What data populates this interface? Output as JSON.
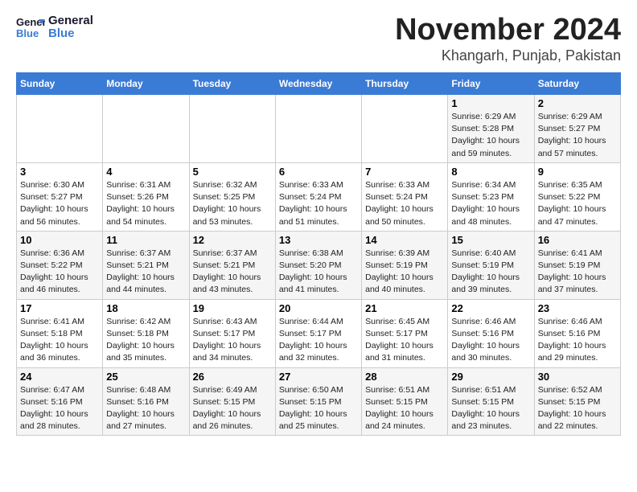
{
  "header": {
    "logo_line1": "General",
    "logo_line2": "Blue",
    "month": "November 2024",
    "location": "Khangarh, Punjab, Pakistan"
  },
  "weekdays": [
    "Sunday",
    "Monday",
    "Tuesday",
    "Wednesday",
    "Thursday",
    "Friday",
    "Saturday"
  ],
  "weeks": [
    [
      {
        "day": "",
        "info": ""
      },
      {
        "day": "",
        "info": ""
      },
      {
        "day": "",
        "info": ""
      },
      {
        "day": "",
        "info": ""
      },
      {
        "day": "",
        "info": ""
      },
      {
        "day": "1",
        "info": "Sunrise: 6:29 AM\nSunset: 5:28 PM\nDaylight: 10 hours\nand 59 minutes."
      },
      {
        "day": "2",
        "info": "Sunrise: 6:29 AM\nSunset: 5:27 PM\nDaylight: 10 hours\nand 57 minutes."
      }
    ],
    [
      {
        "day": "3",
        "info": "Sunrise: 6:30 AM\nSunset: 5:27 PM\nDaylight: 10 hours\nand 56 minutes."
      },
      {
        "day": "4",
        "info": "Sunrise: 6:31 AM\nSunset: 5:26 PM\nDaylight: 10 hours\nand 54 minutes."
      },
      {
        "day": "5",
        "info": "Sunrise: 6:32 AM\nSunset: 5:25 PM\nDaylight: 10 hours\nand 53 minutes."
      },
      {
        "day": "6",
        "info": "Sunrise: 6:33 AM\nSunset: 5:24 PM\nDaylight: 10 hours\nand 51 minutes."
      },
      {
        "day": "7",
        "info": "Sunrise: 6:33 AM\nSunset: 5:24 PM\nDaylight: 10 hours\nand 50 minutes."
      },
      {
        "day": "8",
        "info": "Sunrise: 6:34 AM\nSunset: 5:23 PM\nDaylight: 10 hours\nand 48 minutes."
      },
      {
        "day": "9",
        "info": "Sunrise: 6:35 AM\nSunset: 5:22 PM\nDaylight: 10 hours\nand 47 minutes."
      }
    ],
    [
      {
        "day": "10",
        "info": "Sunrise: 6:36 AM\nSunset: 5:22 PM\nDaylight: 10 hours\nand 46 minutes."
      },
      {
        "day": "11",
        "info": "Sunrise: 6:37 AM\nSunset: 5:21 PM\nDaylight: 10 hours\nand 44 minutes."
      },
      {
        "day": "12",
        "info": "Sunrise: 6:37 AM\nSunset: 5:21 PM\nDaylight: 10 hours\nand 43 minutes."
      },
      {
        "day": "13",
        "info": "Sunrise: 6:38 AM\nSunset: 5:20 PM\nDaylight: 10 hours\nand 41 minutes."
      },
      {
        "day": "14",
        "info": "Sunrise: 6:39 AM\nSunset: 5:19 PM\nDaylight: 10 hours\nand 40 minutes."
      },
      {
        "day": "15",
        "info": "Sunrise: 6:40 AM\nSunset: 5:19 PM\nDaylight: 10 hours\nand 39 minutes."
      },
      {
        "day": "16",
        "info": "Sunrise: 6:41 AM\nSunset: 5:19 PM\nDaylight: 10 hours\nand 37 minutes."
      }
    ],
    [
      {
        "day": "17",
        "info": "Sunrise: 6:41 AM\nSunset: 5:18 PM\nDaylight: 10 hours\nand 36 minutes."
      },
      {
        "day": "18",
        "info": "Sunrise: 6:42 AM\nSunset: 5:18 PM\nDaylight: 10 hours\nand 35 minutes."
      },
      {
        "day": "19",
        "info": "Sunrise: 6:43 AM\nSunset: 5:17 PM\nDaylight: 10 hours\nand 34 minutes."
      },
      {
        "day": "20",
        "info": "Sunrise: 6:44 AM\nSunset: 5:17 PM\nDaylight: 10 hours\nand 32 minutes."
      },
      {
        "day": "21",
        "info": "Sunrise: 6:45 AM\nSunset: 5:17 PM\nDaylight: 10 hours\nand 31 minutes."
      },
      {
        "day": "22",
        "info": "Sunrise: 6:46 AM\nSunset: 5:16 PM\nDaylight: 10 hours\nand 30 minutes."
      },
      {
        "day": "23",
        "info": "Sunrise: 6:46 AM\nSunset: 5:16 PM\nDaylight: 10 hours\nand 29 minutes."
      }
    ],
    [
      {
        "day": "24",
        "info": "Sunrise: 6:47 AM\nSunset: 5:16 PM\nDaylight: 10 hours\nand 28 minutes."
      },
      {
        "day": "25",
        "info": "Sunrise: 6:48 AM\nSunset: 5:16 PM\nDaylight: 10 hours\nand 27 minutes."
      },
      {
        "day": "26",
        "info": "Sunrise: 6:49 AM\nSunset: 5:15 PM\nDaylight: 10 hours\nand 26 minutes."
      },
      {
        "day": "27",
        "info": "Sunrise: 6:50 AM\nSunset: 5:15 PM\nDaylight: 10 hours\nand 25 minutes."
      },
      {
        "day": "28",
        "info": "Sunrise: 6:51 AM\nSunset: 5:15 PM\nDaylight: 10 hours\nand 24 minutes."
      },
      {
        "day": "29",
        "info": "Sunrise: 6:51 AM\nSunset: 5:15 PM\nDaylight: 10 hours\nand 23 minutes."
      },
      {
        "day": "30",
        "info": "Sunrise: 6:52 AM\nSunset: 5:15 PM\nDaylight: 10 hours\nand 22 minutes."
      }
    ]
  ]
}
